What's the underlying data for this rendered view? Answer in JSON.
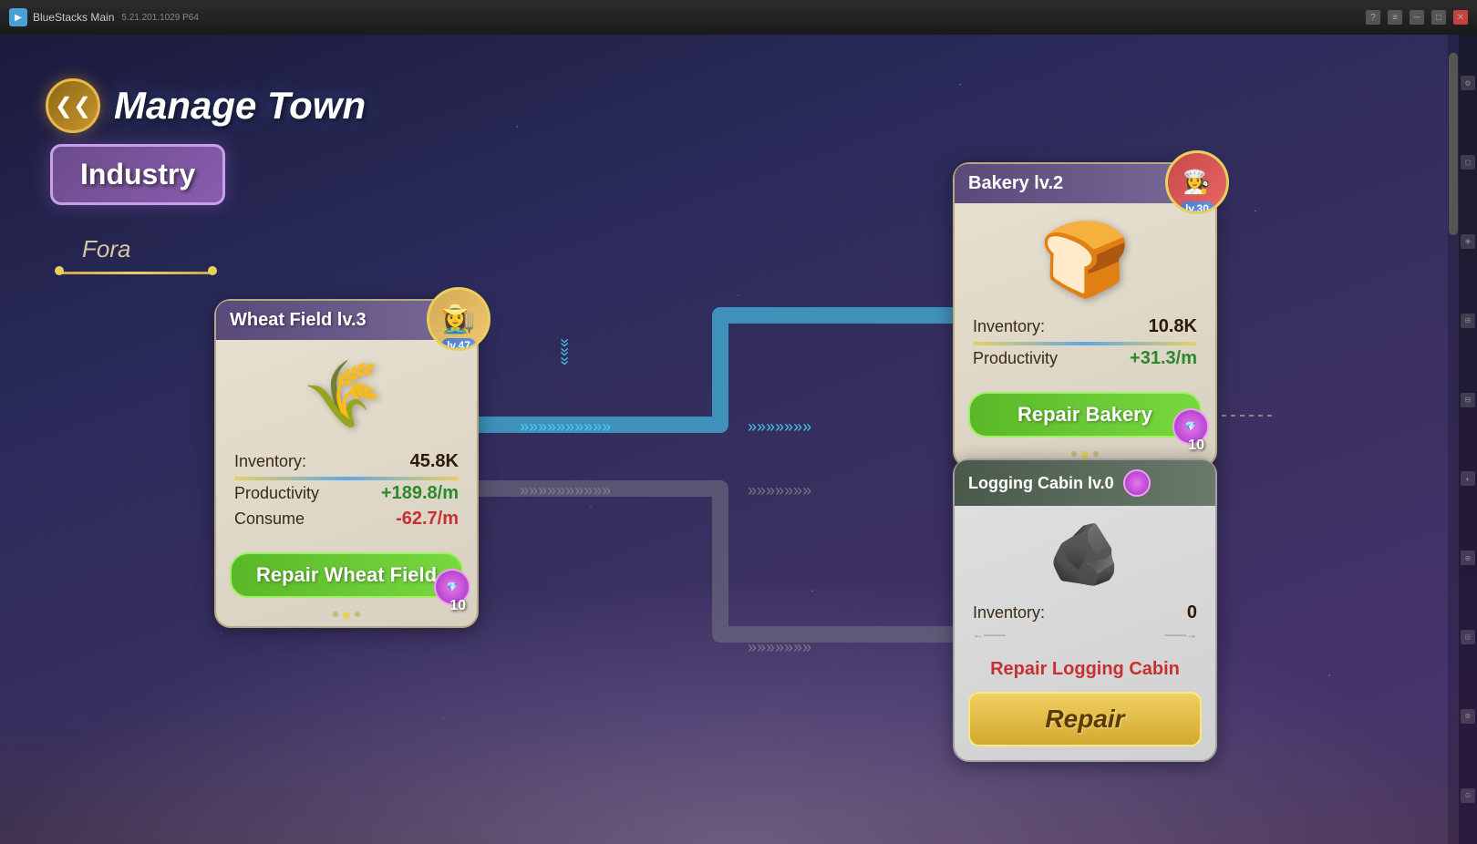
{
  "titleBar": {
    "appName": "BlueStacks Main",
    "version": "5.21.201.1029  P64",
    "controls": [
      "question",
      "menu",
      "minimize",
      "maximize",
      "close"
    ]
  },
  "header": {
    "title": "Manage Town",
    "backLabel": "❮❮"
  },
  "industryBtn": {
    "label": "Industry"
  },
  "foraLabel": "Fora",
  "wheatCard": {
    "title": "Wheat Field lv.3",
    "characterLevel": "lv.47",
    "inventory": {
      "label": "Inventory:",
      "value": "45.8K"
    },
    "productivity": {
      "label": "Productivity",
      "value": "+189.8/m"
    },
    "consume": {
      "label": "Consume",
      "value": "-62.7/m"
    },
    "repairBtn": "Repair Wheat Field",
    "gemCost": "10",
    "icon": "🌾"
  },
  "bakeryCard": {
    "title": "Bakery lv.2",
    "characterLevel": "lv.30",
    "inventory": {
      "label": "Inventory:",
      "value": "10.8K"
    },
    "productivity": {
      "label": "Productivity",
      "value": "+31.3/m"
    },
    "repairBtn": "Repair Bakery",
    "gemCost": "10",
    "icon": "🍞"
  },
  "loggingCard": {
    "title": "Logging Cabin lv.0",
    "inventory": {
      "label": "Inventory:",
      "value": "0"
    },
    "repairLabel": "Repair Logging Cabin",
    "repairBtn": "Repair",
    "icon": "🪨"
  },
  "flowArrows": {
    "blueColor": "#4ad4f8",
    "grayColor": "#888890"
  }
}
